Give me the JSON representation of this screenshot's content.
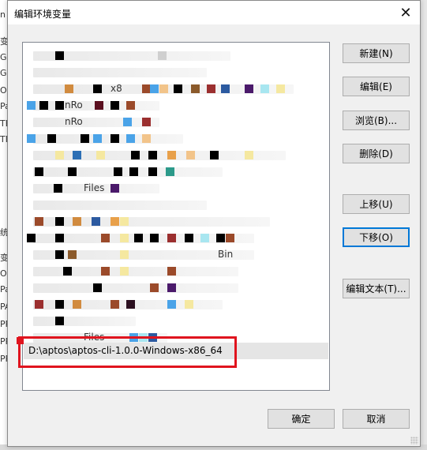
{
  "dialog": {
    "title": "编辑环境变量",
    "close_glyph": "✕"
  },
  "list": {
    "selected_entry": "D:\\aptos\\aptos-cli-1.0.0-Windows-x86_64",
    "visible_fragments": [
      "nRo",
      "nRo",
      "Files",
      "Files",
      "Bin",
      "Files",
      "x8"
    ]
  },
  "buttons": {
    "new": "新建(N)",
    "edit": "编辑(E)",
    "browse": "浏览(B)...",
    "delete": "删除(D)",
    "move_up": "上移(U)",
    "move_down": "下移(O)",
    "edit_text": "编辑文本(T)...",
    "ok": "确定",
    "cancel": "取消"
  },
  "background_fragments": [
    "n",
    "变",
    "Go",
    "Go",
    "O",
    "Pa",
    "TE",
    "TM",
    "统",
    "变",
    "O",
    "Pa",
    "PA",
    "PR",
    "PR",
    "PR"
  ],
  "colors": {
    "highlight_border": "#e0141e",
    "focus_border": "#0078d7"
  }
}
